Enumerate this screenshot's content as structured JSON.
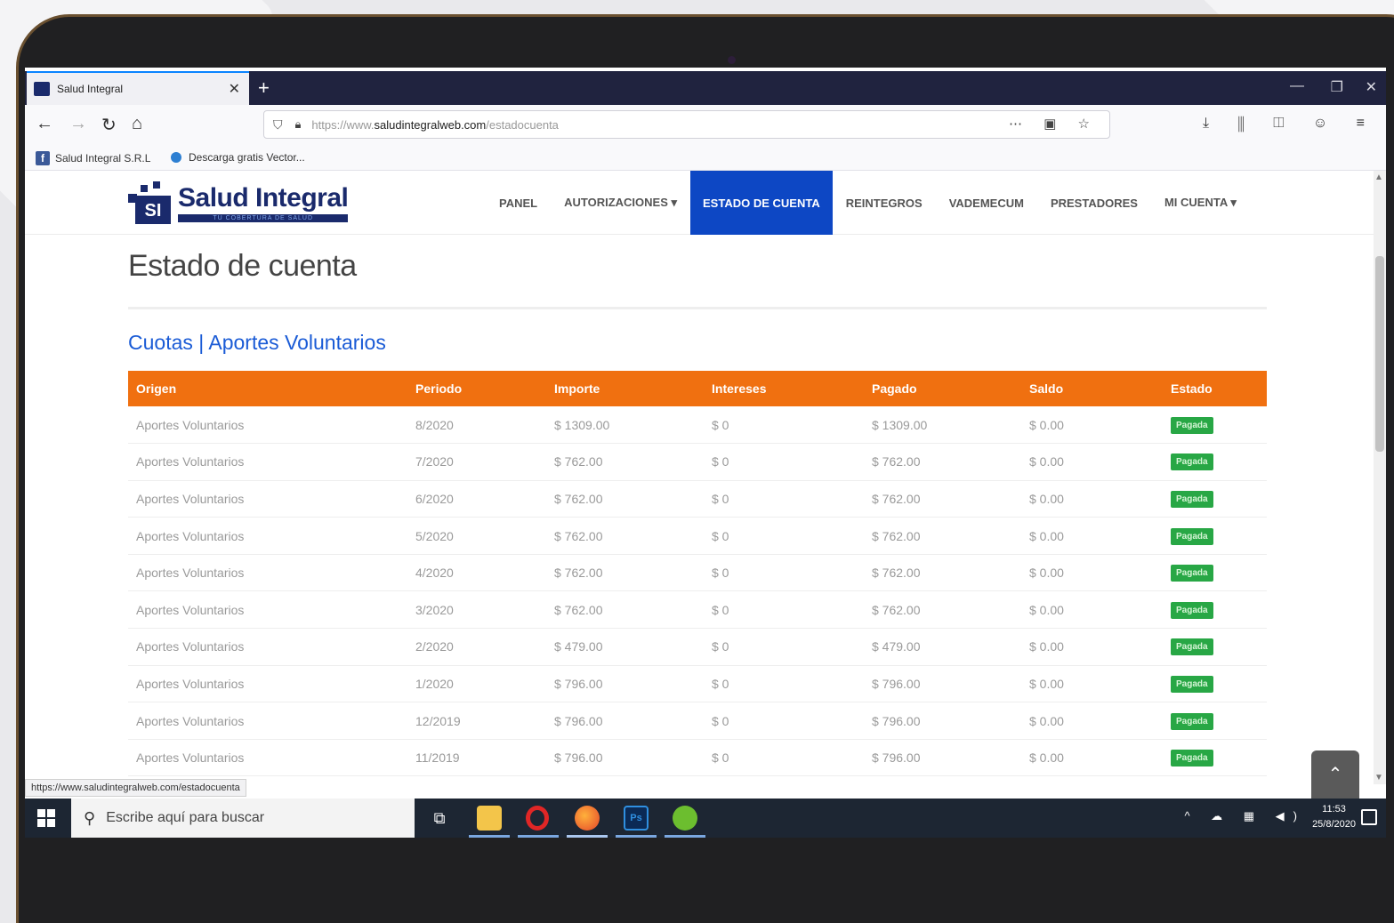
{
  "browser": {
    "tab_title": "Salud Integral",
    "tab_close": "✕",
    "new_tab": "+",
    "window_controls": {
      "minimize": "—",
      "restore": "❐",
      "close": "✕"
    },
    "url_prefix": "https://www.",
    "url_domain": "saludintegralweb.com",
    "url_path": "/estadocuenta",
    "bookmarks": [
      {
        "label": "Salud Integral S.R.L",
        "icon": "facebook-icon"
      },
      {
        "label": "Descarga gratis Vector...",
        "icon": "globe-icon"
      }
    ]
  },
  "site": {
    "logo_name": "Salud Integral",
    "logo_tagline": "TU COBERTURA DE SALUD",
    "logo_mark": "SI",
    "nav": [
      {
        "label": "PANEL",
        "active": false
      },
      {
        "label": "AUTORIZACIONES ▾",
        "active": false
      },
      {
        "label": "ESTADO DE CUENTA",
        "active": true
      },
      {
        "label": "REINTEGROS",
        "active": false
      },
      {
        "label": "VADEMECUM",
        "active": false
      },
      {
        "label": "PRESTADORES",
        "active": false
      },
      {
        "label": "MI CUENTA ▾",
        "active": false
      }
    ]
  },
  "main": {
    "page_title": "Estado de cuenta",
    "breadcrumb": "Cuotas | Aportes Voluntarios",
    "table": {
      "columns": [
        "Origen",
        "Periodo",
        "Importe",
        "Intereses",
        "Pagado",
        "Saldo",
        "Estado"
      ],
      "rows": [
        [
          "Aportes Voluntarios",
          "8/2020",
          "$ 1309.00",
          "$ 0",
          "$ 1309.00",
          "$ 0.00",
          "Pagada"
        ],
        [
          "Aportes Voluntarios",
          "7/2020",
          "$ 762.00",
          "$ 0",
          "$ 762.00",
          "$ 0.00",
          "Pagada"
        ],
        [
          "Aportes Voluntarios",
          "6/2020",
          "$ 762.00",
          "$ 0",
          "$ 762.00",
          "$ 0.00",
          "Pagada"
        ],
        [
          "Aportes Voluntarios",
          "5/2020",
          "$ 762.00",
          "$ 0",
          "$ 762.00",
          "$ 0.00",
          "Pagada"
        ],
        [
          "Aportes Voluntarios",
          "4/2020",
          "$ 762.00",
          "$ 0",
          "$ 762.00",
          "$ 0.00",
          "Pagada"
        ],
        [
          "Aportes Voluntarios",
          "3/2020",
          "$ 762.00",
          "$ 0",
          "$ 762.00",
          "$ 0.00",
          "Pagada"
        ],
        [
          "Aportes Voluntarios",
          "2/2020",
          "$ 479.00",
          "$ 0",
          "$ 479.00",
          "$ 0.00",
          "Pagada"
        ],
        [
          "Aportes Voluntarios",
          "1/2020",
          "$ 796.00",
          "$ 0",
          "$ 796.00",
          "$ 0.00",
          "Pagada"
        ],
        [
          "Aportes Voluntarios",
          "12/2019",
          "$ 796.00",
          "$ 0",
          "$ 796.00",
          "$ 0.00",
          "Pagada"
        ],
        [
          "Aportes Voluntarios",
          "11/2019",
          "$ 796.00",
          "$ 0",
          "$ 796.00",
          "$ 0.00",
          "Pagada"
        ]
      ]
    },
    "status_url": "https://www.saludintegralweb.com/estadocuenta",
    "scroll_top_label": "⌃"
  },
  "taskbar": {
    "search_placeholder": "Escribe aquí para buscar",
    "clock_time": "11:53",
    "clock_date": "25/8/2020",
    "tray_icons": "^ ☁ ▦ ◀)"
  },
  "colors": {
    "header_orange": "#f07010",
    "nav_active_blue": "#0d47c4",
    "badge_green": "#28a745",
    "brand_navy": "#1a2a6c"
  }
}
